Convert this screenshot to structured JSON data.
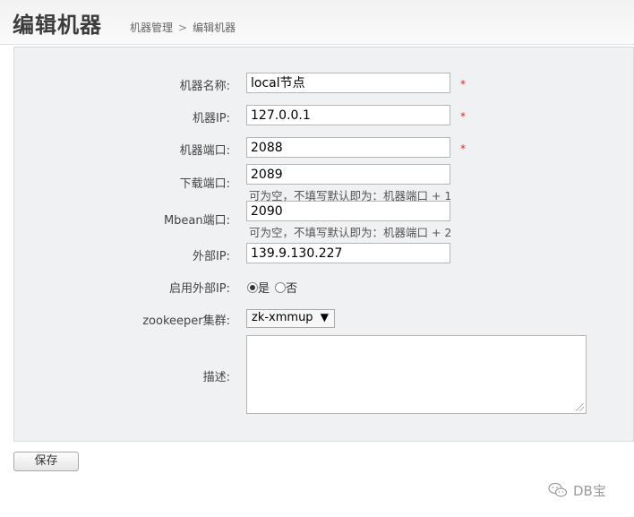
{
  "header": {
    "title": "编辑机器",
    "breadcrumb": [
      "机器管理",
      "编辑机器"
    ],
    "breadcrumb_sep": ">"
  },
  "form": {
    "name": {
      "label": "机器名称:",
      "value": "local节点",
      "required": "*"
    },
    "ip": {
      "label": "机器IP:",
      "value": "127.0.0.1",
      "required": "*"
    },
    "port": {
      "label": "机器端口:",
      "value": "2088",
      "required": "*"
    },
    "download_port": {
      "label": "下载端口:",
      "value": "2089",
      "hint": "可为空，不填写默认即为：机器端口 + 1"
    },
    "mbean_port": {
      "label": "Mbean端口:",
      "value": "2090",
      "hint": "可为空，不填写默认即为：机器端口 + 2"
    },
    "external_ip": {
      "label": "外部IP:",
      "value": "139.9.130.227"
    },
    "enable_external_ip": {
      "label": "启用外部IP:",
      "options": [
        "是",
        "否"
      ],
      "selected": "是"
    },
    "zookeeper": {
      "label": "zookeeper集群:",
      "selected": "zk-xmmup"
    },
    "description": {
      "label": "描述:",
      "value": ""
    }
  },
  "actions": {
    "save_label": "保存"
  },
  "watermark": {
    "text": "DB宝"
  },
  "colors": {
    "required": "#d9302c",
    "panel_bg": "#f0f1f2"
  }
}
